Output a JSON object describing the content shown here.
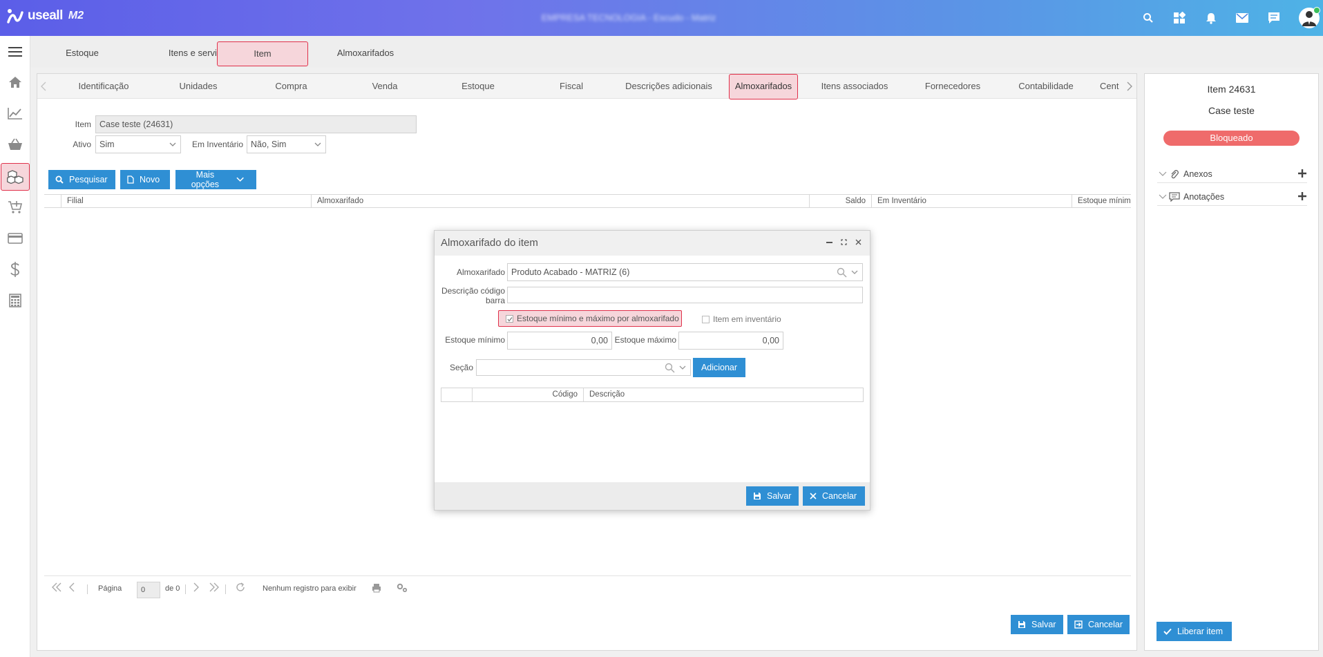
{
  "app": {
    "brand": "useall",
    "version_label": "M2",
    "company_blurred": "EMPRESA TECNOLOGIA - Escudo - Matriz"
  },
  "colors": {
    "accent": "#2f8fd4",
    "highlight_border": "#e0304a",
    "highlight_fill": "#f6d6db",
    "status_blocked": "#ef6b6b",
    "topbar_start": "#5b5ee8",
    "topbar_end": "#4eb3e6"
  },
  "topbar_icons": [
    "search-icon",
    "app-switch-icon",
    "bell-icon",
    "mail-icon",
    "chat-icon",
    "user-avatar"
  ],
  "rail_icons": [
    "menu-icon",
    "home-icon",
    "chart-line-icon",
    "basket-icon",
    "boxes-icon",
    "cart-add-icon",
    "card-icon",
    "dollar-icon",
    "calculator-icon"
  ],
  "module_tabs": [
    {
      "label": "Estoque"
    },
    {
      "label": "Itens e serviços"
    },
    {
      "label": "Item"
    },
    {
      "label": "Almoxarifados"
    }
  ],
  "sub_tabs": [
    {
      "label": "Identificação"
    },
    {
      "label": "Unidades"
    },
    {
      "label": "Compra"
    },
    {
      "label": "Venda"
    },
    {
      "label": "Estoque"
    },
    {
      "label": "Fiscal"
    },
    {
      "label": "Descrições adicionais"
    },
    {
      "label": "Almoxarifados"
    },
    {
      "label": "Itens associados"
    },
    {
      "label": "Fornecedores"
    },
    {
      "label": "Contabilidade"
    },
    {
      "label": "Cent"
    }
  ],
  "filters": {
    "item_label": "Item",
    "item_value": "Case teste (24631)",
    "ativo_label": "Ativo",
    "ativo_value": "Sim",
    "inventario_label": "Em Inventário",
    "inventario_value": "Não, Sim"
  },
  "actions": {
    "search": "Pesquisar",
    "new": "Novo",
    "more": "Mais opções"
  },
  "grid": {
    "columns": [
      "Filial",
      "Almoxarifado",
      "Saldo",
      "Em Inventário",
      "Estoque mínimo"
    ],
    "rows": []
  },
  "pager": {
    "page_label": "Página",
    "page_value": "0",
    "of_label": "de 0",
    "empty": "Nenhum registro para exibir"
  },
  "footer": {
    "save": "Salvar",
    "cancel": "Cancelar"
  },
  "right_panel": {
    "title": "Item 24631",
    "subtitle": "Case teste",
    "status": "Bloqueado",
    "sections": [
      {
        "label": "Anexos",
        "icon": "paperclip-icon"
      },
      {
        "label": "Anotações",
        "icon": "note-icon"
      }
    ],
    "release_button": "Liberar item"
  },
  "modal": {
    "title": "Almoxarifado do item",
    "almox_label": "Almoxarifado",
    "almox_value": "Produto Acabado - MATRIZ (6)",
    "barcode_label_1": "Descrição código",
    "barcode_label_2": "barra",
    "barcode_value": "",
    "chk_minmax_label": "Estoque mínimo e máximo por almoxarifado",
    "chk_minmax_checked": true,
    "chk_inventory_label": "Item em inventário",
    "chk_inventory_checked": false,
    "min_label": "Estoque mínimo",
    "min_value": "0,00",
    "max_label": "Estoque máximo",
    "max_value": "0,00",
    "section_label": "Seção",
    "section_value": "",
    "add_button": "Adicionar",
    "table_columns": [
      "Código",
      "Descrição"
    ],
    "save": "Salvar",
    "cancel": "Cancelar"
  }
}
